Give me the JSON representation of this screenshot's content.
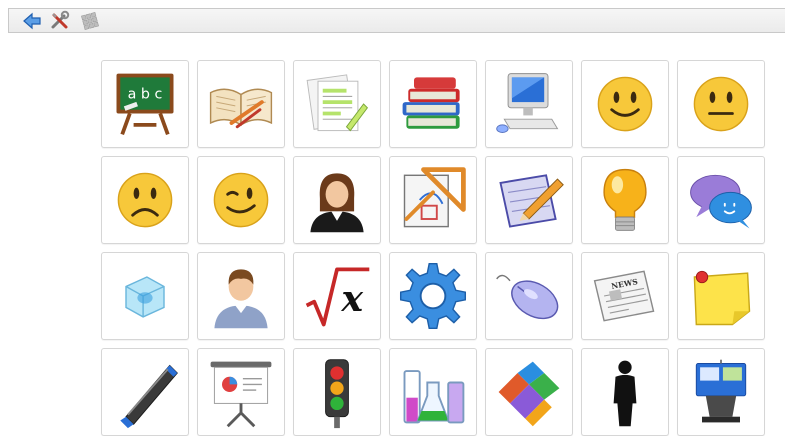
{
  "toolbar": {
    "buttons": [
      {
        "name": "back-button",
        "icon": "back-arrow-icon"
      },
      {
        "name": "settings-button",
        "icon": "tools-icon"
      },
      {
        "name": "grid-button",
        "icon": "grid-icon"
      }
    ]
  },
  "symbols": [
    {
      "name": "symbol-school",
      "icon": "chalkboard-abc-icon",
      "text": "a b c"
    },
    {
      "name": "symbol-read",
      "icon": "open-book-icon"
    },
    {
      "name": "symbol-notes",
      "icon": "highlighted-papers-icon"
    },
    {
      "name": "symbol-books",
      "icon": "book-stack-icon"
    },
    {
      "name": "symbol-computer",
      "icon": "computer-icon"
    },
    {
      "name": "symbol-happy",
      "icon": "smiley-happy-icon"
    },
    {
      "name": "symbol-neutral",
      "icon": "smiley-neutral-icon"
    },
    {
      "name": "symbol-sad",
      "icon": "smiley-sad-icon"
    },
    {
      "name": "symbol-wink",
      "icon": "smiley-wink-icon"
    },
    {
      "name": "symbol-woman",
      "icon": "woman-icon"
    },
    {
      "name": "symbol-geometry",
      "icon": "set-square-icon"
    },
    {
      "name": "symbol-write",
      "icon": "notepad-pencil-icon"
    },
    {
      "name": "symbol-idea",
      "icon": "light-bulb-icon"
    },
    {
      "name": "symbol-chat",
      "icon": "speech-bubbles-icon"
    },
    {
      "name": "symbol-ice",
      "icon": "ice-cube-icon"
    },
    {
      "name": "symbol-man",
      "icon": "man-icon"
    },
    {
      "name": "symbol-math",
      "icon": "square-root-x-icon",
      "text": "x"
    },
    {
      "name": "symbol-settings",
      "icon": "gear-icon"
    },
    {
      "name": "symbol-mouse",
      "icon": "mouse-icon"
    },
    {
      "name": "symbol-news",
      "icon": "newspaper-icon",
      "text": "NEWS"
    },
    {
      "name": "symbol-note",
      "icon": "sticky-note-icon"
    },
    {
      "name": "symbol-marker",
      "icon": "marker-icon"
    },
    {
      "name": "symbol-presentation",
      "icon": "presentation-board-icon"
    },
    {
      "name": "symbol-traffic",
      "icon": "traffic-light-icon"
    },
    {
      "name": "symbol-science",
      "icon": "lab-flasks-icon"
    },
    {
      "name": "symbol-puzzle",
      "icon": "tetris-blocks-icon"
    },
    {
      "name": "symbol-person",
      "icon": "person-silhouette-icon"
    },
    {
      "name": "symbol-keynote",
      "icon": "podium-icon"
    }
  ]
}
